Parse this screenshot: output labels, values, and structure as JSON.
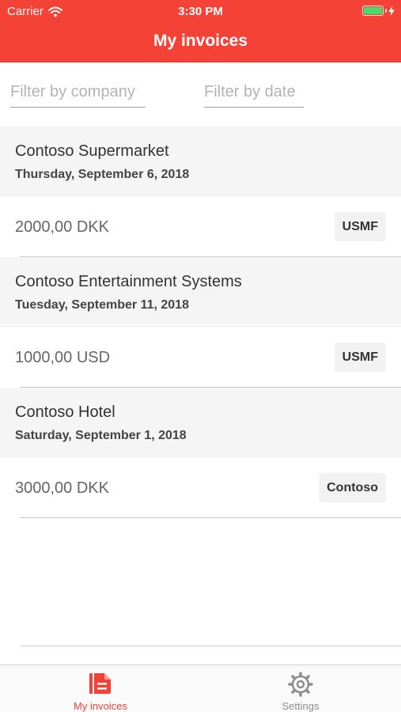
{
  "status_bar": {
    "carrier": "Carrier",
    "time": "3:30 PM"
  },
  "header": {
    "title": "My invoices"
  },
  "filters": {
    "company_placeholder": "Filter by company",
    "date_placeholder": "Filter by date"
  },
  "invoices": [
    {
      "company": "Contoso Supermarket",
      "date": "Thursday, September 6, 2018",
      "amount": "2000,00 DKK",
      "tag": "USMF"
    },
    {
      "company": "Contoso Entertainment Systems",
      "date": "Tuesday, September 11, 2018",
      "amount": "1000,00 USD",
      "tag": "USMF"
    },
    {
      "company": "Contoso Hotel",
      "date": "Saturday, September 1, 2018",
      "amount": "3000,00 DKK",
      "tag": "Contoso"
    }
  ],
  "tabs": [
    {
      "label": "My invoices",
      "icon": "document-icon",
      "active": true
    },
    {
      "label": "Settings",
      "icon": "gear-icon",
      "active": false
    }
  ],
  "colors": {
    "brand": "#f44336",
    "battery": "#4cd964",
    "inactive_tab": "#8e8e8e"
  }
}
